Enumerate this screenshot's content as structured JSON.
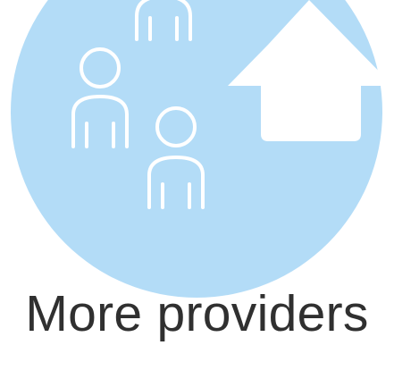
{
  "tile": {
    "caption": "More providers",
    "illustration_icon": "people-and-home-icon"
  },
  "colors": {
    "circle": "#b3dcf7",
    "outline": "#ffffff",
    "text": "#303030",
    "background": "#ffffff"
  }
}
